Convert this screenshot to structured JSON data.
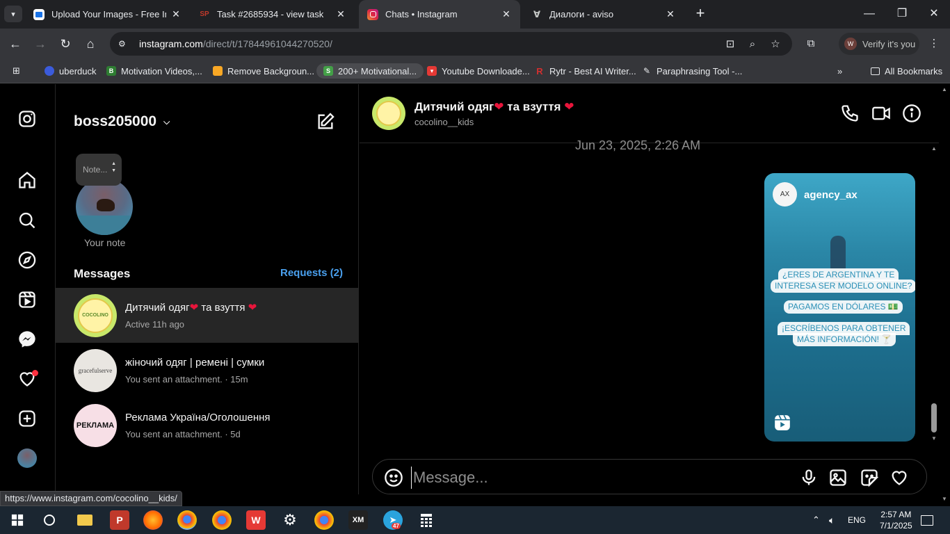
{
  "browser": {
    "tabs": [
      {
        "title": "Upload Your Images - Free Imag",
        "favicon": "image-upload-icon",
        "color": "#1a73e8"
      },
      {
        "title": "Task #2685934 - view task",
        "favicon": "sp-icon",
        "color": "#c0392b"
      },
      {
        "title": "Chats • Instagram",
        "favicon": "instagram-icon",
        "color": "#d6249f"
      },
      {
        "title": "Диалоги - aviso",
        "favicon": "aviso-icon",
        "color": "#9aa0a6"
      }
    ],
    "url": {
      "host": "instagram.com",
      "path": "/direct/t/17844961044270520/"
    },
    "profile_label": "Verify it's you",
    "profile_initial": "W",
    "bookmarks": [
      {
        "label": "uberduck",
        "color": "#3b5bdb"
      },
      {
        "label": "Motivation Videos,...",
        "color": "#2e7d32"
      },
      {
        "label": "Remove Backgroun...",
        "color": "#f9a825"
      },
      {
        "label": "200+ Motivational...",
        "color": "#43a047"
      },
      {
        "label": "Youtube Downloade...",
        "color": "#e53935"
      },
      {
        "label": "Rytr - Best AI Writer...",
        "color": "#d32f2f"
      },
      {
        "label": "Paraphrasing Tool -...",
        "color": "#9aa0a6"
      }
    ],
    "all_bookmarks": "All Bookmarks",
    "status_url": "https://www.instagram.com/cocolino__kids/"
  },
  "inbox": {
    "username": "boss205000",
    "note_placeholder": "Note...",
    "your_note": "Your note",
    "messages_label": "Messages",
    "requests_label": "Requests (2)",
    "conversations": [
      {
        "name": "Дитячий одяг",
        "name_tail": " та взуття ",
        "subtitle": "Active 11h ago",
        "avatar_text": "COCOLINO",
        "avatar_bg": "#c8e86a",
        "selected": true
      },
      {
        "name": "жіночий одяг | ремені | сумки",
        "subtitle": "You sent an attachment. · 15m",
        "avatar_text": "gracefulserve",
        "avatar_bg": "#e9e6e1",
        "selected": false
      },
      {
        "name": "Реклама Україна/Оголошення",
        "subtitle": "You sent an attachment. · 5d",
        "avatar_text": "РЕКЛАМА",
        "avatar_bg": "#f7dfe6",
        "selected": false
      }
    ]
  },
  "chat": {
    "name": "Дитячий одяг",
    "name_tail": " та взуття ",
    "handle": "cocolino__kids",
    "timestamp": "Jun 23, 2025, 2:26 AM",
    "reel": {
      "account": "agency_ax",
      "logo_text": "AX",
      "lines": [
        "¿ERES DE ARGENTINA Y TE",
        "INTERESA SER MODELO ONLINE?",
        "PAGAMOS EN DÓLARES 💵",
        "¡ESCRÍBENOS PARA OBTENER",
        "MÁS INFORMACIÓN! 🍸"
      ]
    },
    "input_placeholder": "Message..."
  },
  "taskbar": {
    "lang": "ENG",
    "time": "2:57 AM",
    "date": "7/1/2025",
    "telegram_badge": "47"
  },
  "colors": {
    "accent_blue": "#4aa0ee",
    "heart_red": "#e8153b",
    "notification_dot": "#ff3040"
  }
}
